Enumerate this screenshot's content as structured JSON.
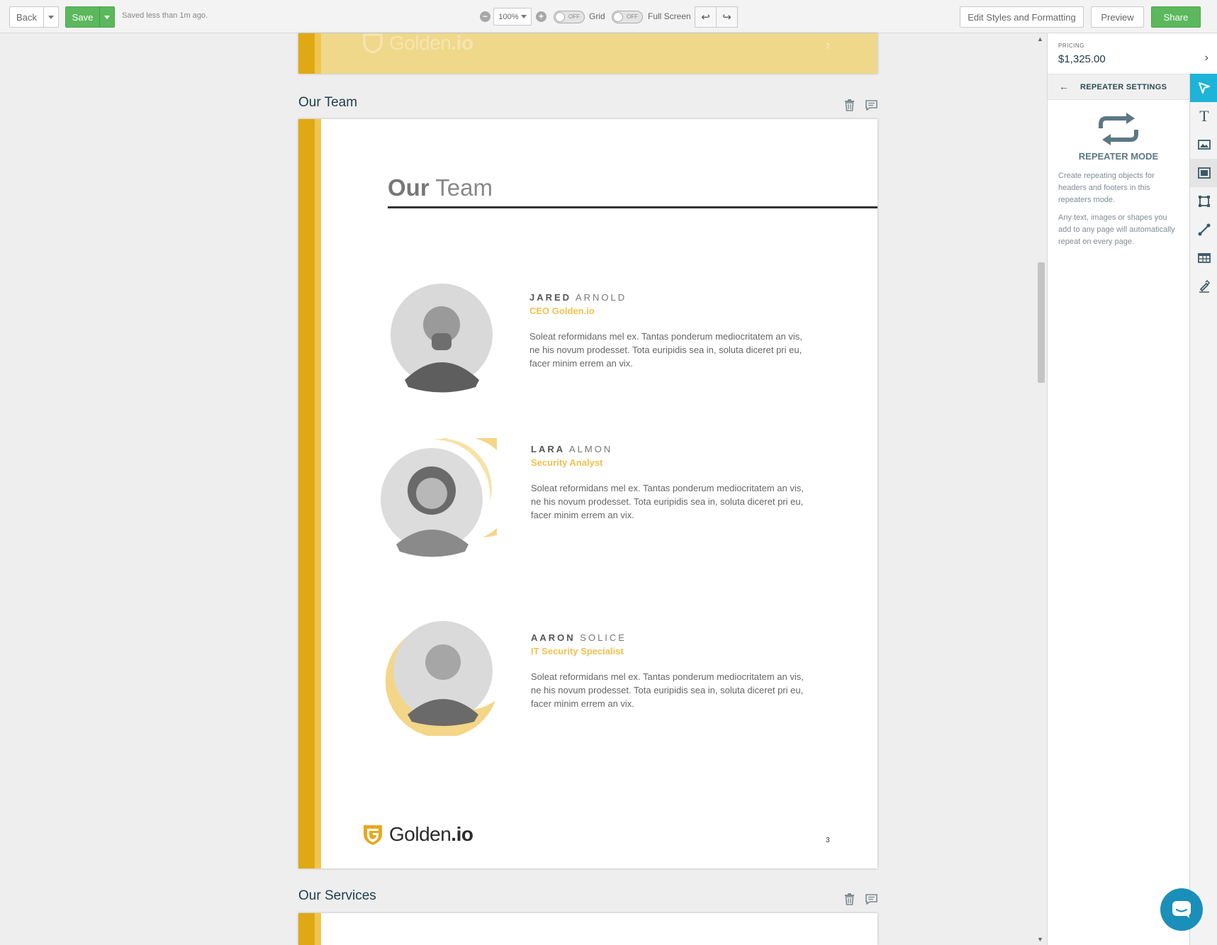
{
  "toolbar": {
    "back_label": "Back",
    "save_label": "Save",
    "saved_status": "Saved less than 1m ago.",
    "zoom_value": "100%",
    "grid_toggle": {
      "state": "OFF",
      "label": "Grid"
    },
    "fullscreen_toggle": {
      "state": "OFF",
      "label": "Full Screen"
    },
    "edit_styles_label": "Edit Styles and Formatting",
    "preview_label": "Preview",
    "share_label": "Share"
  },
  "document": {
    "prev_page": {
      "logo_name": "Golden",
      "logo_suffix": ".io",
      "page_number": "2"
    },
    "team_section": {
      "title": "Our Team",
      "heading_bold": "Our",
      "heading_light": " Team",
      "members": [
        {
          "first": "JARED",
          "last": " ARNOLD",
          "role": "CEO Golden.io",
          "bio": "Soleat reformidans mel ex. Tantas ponderum mediocritatem an vis, ne his novum prodesset. Tota euripidis sea in, soluta diceret pri eu, facer minim errem an vix."
        },
        {
          "first": "LARA",
          "last": " ALMON",
          "role": "Security Analyst",
          "bio": "Soleat reformidans mel ex. Tantas ponderum mediocritatem an vis, ne his novum prodesset. Tota euripidis sea in, soluta diceret pri eu, facer minim errem an vix."
        },
        {
          "first": "AARON",
          "last": " SOLICE",
          "role": "IT Security Specialist",
          "bio": "Soleat reformidans mel ex. Tantas ponderum mediocritatem an vis, ne his novum prodesset. Tota euripidis sea in, soluta diceret pri eu, facer minim errem an vix."
        }
      ],
      "logo_name": "Golden",
      "logo_suffix": ".io",
      "page_number": "3"
    },
    "services_section": {
      "title": "Our Services"
    }
  },
  "panel": {
    "pricing_label": "PRICING",
    "pricing_value": "$1,325.00",
    "repeater_title": "REPEATER SETTINGS",
    "mode_title": "REPEATER MODE",
    "desc_1": "Create repeating objects for headers and footers in this repeaters mode.",
    "desc_2": "Any text, images or shapes you add to any page will automatically repeat on every page.",
    "tools": [
      "cursor-icon",
      "text-icon",
      "image-icon",
      "video-icon",
      "shape-icon",
      "line-icon",
      "table-icon",
      "signature-icon"
    ]
  },
  "colors": {
    "brand_gold": "#e0a812",
    "accent_green": "#5bb85c",
    "tool_active": "#1eb3d8"
  }
}
